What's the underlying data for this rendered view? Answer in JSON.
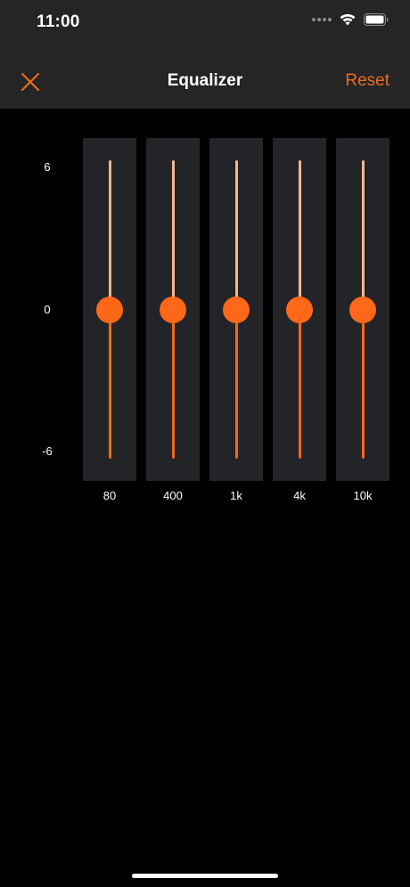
{
  "status_bar": {
    "time": "11:00",
    "icons": [
      "signal-dots-icon",
      "wifi-icon",
      "battery-icon"
    ]
  },
  "nav": {
    "close_icon": "close-icon",
    "title": "Equalizer",
    "reset_label": "Reset"
  },
  "scale": {
    "max": "6",
    "mid": "0",
    "min": "-6",
    "range_db": [
      -6,
      6
    ]
  },
  "bands": [
    {
      "label": "80",
      "gain_db": 0
    },
    {
      "label": "400",
      "gain_db": 0
    },
    {
      "label": "1k",
      "gain_db": 0
    },
    {
      "label": "4k",
      "gain_db": 0
    },
    {
      "label": "10k",
      "gain_db": 0
    }
  ],
  "colors": {
    "accent": "#ee6a1f",
    "thumb": "#ff6719",
    "track_upper": "#f3b791",
    "band_background": "#232427",
    "bar_background": "#252525",
    "page_background": "#000000"
  }
}
